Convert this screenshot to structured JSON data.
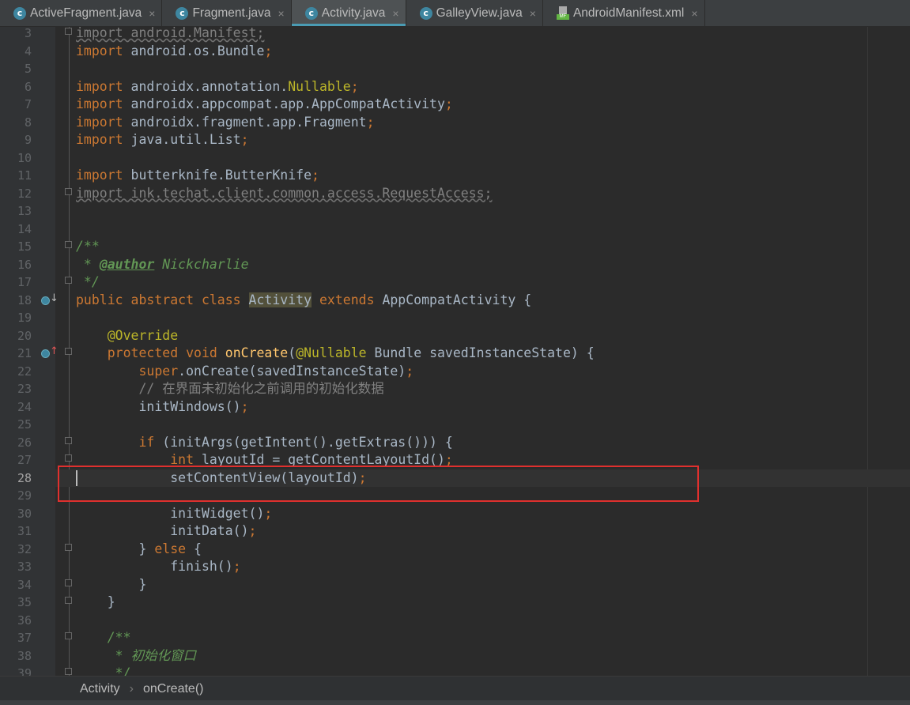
{
  "tabs": [
    {
      "label": "ActiveFragment.java",
      "icon": "java-class-icon",
      "active": false
    },
    {
      "label": "Fragment.java",
      "icon": "java-class-icon",
      "active": false
    },
    {
      "label": "Activity.java",
      "icon": "java-class-icon",
      "active": true
    },
    {
      "label": "GalleyView.java",
      "icon": "java-class-icon",
      "active": false
    },
    {
      "label": "AndroidManifest.xml",
      "icon": "manifest-file-icon",
      "active": false
    }
  ],
  "tab_close": "×",
  "tab_class_glyph": "c",
  "manifest_glyph": "MF",
  "current_line": 28,
  "code": [
    {
      "n": 3,
      "t": [
        [
          "un",
          "import android.Manifest;"
        ]
      ]
    },
    {
      "n": 4,
      "t": [
        [
          "kw",
          "import "
        ],
        [
          "pl",
          "android.os.Bundle"
        ],
        [
          "kw",
          ";"
        ]
      ]
    },
    {
      "n": 5,
      "t": []
    },
    {
      "n": 6,
      "t": [
        [
          "kw",
          "import "
        ],
        [
          "pl",
          "androidx.annotation."
        ],
        [
          "an",
          "Nullable"
        ],
        [
          "kw",
          ";"
        ]
      ]
    },
    {
      "n": 7,
      "t": [
        [
          "kw",
          "import "
        ],
        [
          "pl",
          "androidx.appcompat.app.AppCompatActivity"
        ],
        [
          "kw",
          ";"
        ]
      ]
    },
    {
      "n": 8,
      "t": [
        [
          "kw",
          "import "
        ],
        [
          "pl",
          "androidx.fragment.app.Fragment"
        ],
        [
          "kw",
          ";"
        ]
      ]
    },
    {
      "n": 9,
      "t": [
        [
          "kw",
          "import "
        ],
        [
          "pl",
          "java.util.List"
        ],
        [
          "kw",
          ";"
        ]
      ]
    },
    {
      "n": 10,
      "t": []
    },
    {
      "n": 11,
      "t": [
        [
          "kw",
          "import "
        ],
        [
          "pl",
          "butterknife.ButterKnife"
        ],
        [
          "kw",
          ";"
        ]
      ]
    },
    {
      "n": 12,
      "t": [
        [
          "un",
          "import ink.techat.client.common.access.RequestAccess;"
        ]
      ]
    },
    {
      "n": 13,
      "t": []
    },
    {
      "n": 14,
      "t": []
    },
    {
      "n": 15,
      "t": [
        [
          "jd",
          "/**"
        ]
      ]
    },
    {
      "n": 16,
      "t": [
        [
          "jd",
          " * "
        ],
        [
          "jt",
          "@author"
        ],
        [
          "jd",
          " Nickcharlie"
        ]
      ]
    },
    {
      "n": 17,
      "t": [
        [
          "jd",
          " */"
        ]
      ]
    },
    {
      "n": 18,
      "t": [
        [
          "kw",
          "public abstract class "
        ],
        [
          "hl",
          "Activity"
        ],
        [
          "kw",
          " extends "
        ],
        [
          "pl",
          "AppCompatActivity {"
        ]
      ]
    },
    {
      "n": 19,
      "t": []
    },
    {
      "n": 20,
      "t": [
        [
          "pl",
          "    "
        ],
        [
          "an",
          "@Override"
        ]
      ]
    },
    {
      "n": 21,
      "t": [
        [
          "pl",
          "    "
        ],
        [
          "kw",
          "protected void "
        ],
        [
          "md",
          "onCreate"
        ],
        [
          "pl",
          "("
        ],
        [
          "an",
          "@Nullable"
        ],
        [
          "pl",
          " Bundle savedInstanceState) {"
        ]
      ]
    },
    {
      "n": 22,
      "t": [
        [
          "pl",
          "        "
        ],
        [
          "kw",
          "super"
        ],
        [
          "pl",
          ".onCreate(savedInstanceState)"
        ],
        [
          "kw",
          ";"
        ]
      ]
    },
    {
      "n": 23,
      "t": [
        [
          "pl",
          "        "
        ],
        [
          "cm",
          "// 在界面未初始化之前调用的初始化数据"
        ]
      ]
    },
    {
      "n": 24,
      "t": [
        [
          "pl",
          "        initWindows()"
        ],
        [
          "kw",
          ";"
        ]
      ]
    },
    {
      "n": 25,
      "t": []
    },
    {
      "n": 26,
      "t": [
        [
          "pl",
          "        "
        ],
        [
          "kw",
          "if "
        ],
        [
          "pl",
          "(initArgs(getIntent().getExtras())) {"
        ]
      ]
    },
    {
      "n": 27,
      "t": [
        [
          "pl",
          "            "
        ],
        [
          "kw",
          "int "
        ],
        [
          "pl",
          "layoutId = getContentLayoutId()"
        ],
        [
          "kw",
          ";"
        ]
      ]
    },
    {
      "n": 28,
      "t": [
        [
          "pl",
          "            setContentView(layoutId)"
        ],
        [
          "kw",
          ";"
        ]
      ]
    },
    {
      "n": 29,
      "t": []
    },
    {
      "n": 30,
      "t": [
        [
          "pl",
          "            initWidget()"
        ],
        [
          "kw",
          ";"
        ]
      ]
    },
    {
      "n": 31,
      "t": [
        [
          "pl",
          "            initData()"
        ],
        [
          "kw",
          ";"
        ]
      ]
    },
    {
      "n": 32,
      "t": [
        [
          "pl",
          "        } "
        ],
        [
          "kw",
          "else "
        ],
        [
          "pl",
          "{"
        ]
      ]
    },
    {
      "n": 33,
      "t": [
        [
          "pl",
          "            finish()"
        ],
        [
          "kw",
          ";"
        ]
      ]
    },
    {
      "n": 34,
      "t": [
        [
          "pl",
          "        }"
        ]
      ]
    },
    {
      "n": 35,
      "t": [
        [
          "pl",
          "    }"
        ]
      ]
    },
    {
      "n": 36,
      "t": []
    },
    {
      "n": 37,
      "t": [
        [
          "pl",
          "    "
        ],
        [
          "jd",
          "/**"
        ]
      ]
    },
    {
      "n": 38,
      "t": [
        [
          "pl",
          "     "
        ],
        [
          "jd",
          "* 初始化窗口"
        ]
      ]
    },
    {
      "n": 39,
      "t": [
        [
          "pl",
          "     "
        ],
        [
          "jd",
          "*/"
        ]
      ]
    }
  ],
  "gutter_icons": [
    {
      "line": 18,
      "icon": "implemented-down-icon",
      "arrow": "↓",
      "color": "#bbbbbb"
    },
    {
      "line": 21,
      "icon": "overrides-up-icon",
      "arrow": "↑",
      "color": "#e05555"
    }
  ],
  "fold_lines": [
    3,
    12,
    15,
    17,
    21,
    26,
    27,
    32,
    34,
    35,
    37,
    39
  ],
  "breadcrumb": {
    "items": [
      "Activity",
      "onCreate()"
    ],
    "separator": "›"
  },
  "colors": {
    "keyword": "#cc7832",
    "annotation": "#bbb529",
    "javadoc": "#629755",
    "highlight_box": "#e0302e",
    "accent": "#4a9bb3"
  }
}
